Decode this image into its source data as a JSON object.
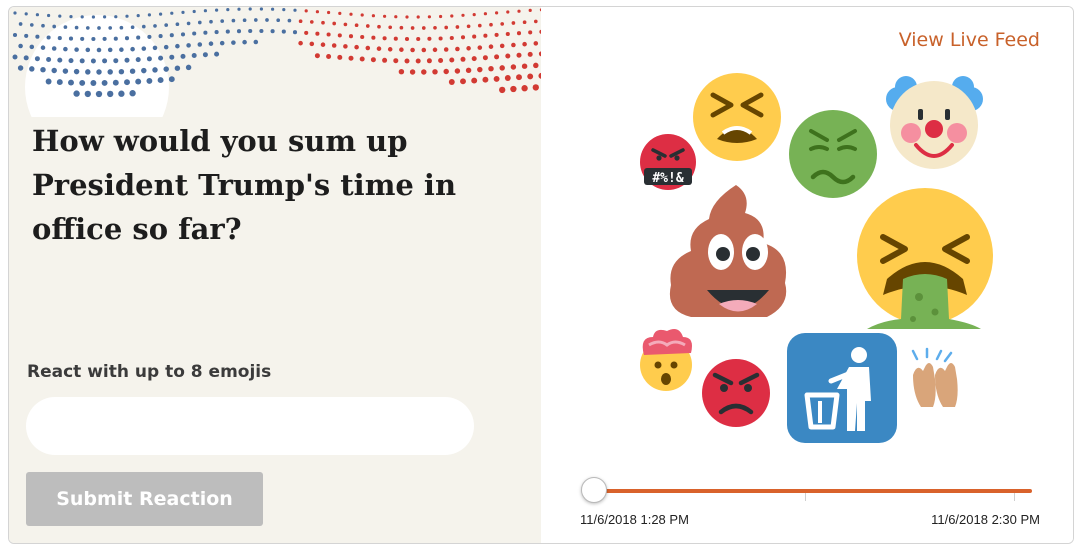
{
  "question": {
    "text": "How would you sum up President Trump's time in office so far?"
  },
  "form": {
    "react_label": "React with up to 8 emojis",
    "input_value": "",
    "input_placeholder": "",
    "submit_label": "Submit Reaction"
  },
  "feed": {
    "link_label": "View Live Feed"
  },
  "emojis": [
    {
      "name": "pouting-face-with-symbols"
    },
    {
      "name": "tired-face"
    },
    {
      "name": "nauseated-face"
    },
    {
      "name": "clown-face"
    },
    {
      "name": "pile-of-poo"
    },
    {
      "name": "face-vomiting"
    },
    {
      "name": "exploding-head"
    },
    {
      "name": "angry-face"
    },
    {
      "name": "put-litter-in-its-place"
    },
    {
      "name": "raising-hands"
    }
  ],
  "symbol_text": "#%!&",
  "timeline": {
    "start_label": "11/6/2018 1:28 PM",
    "end_label": "11/6/2018 2:30 PM",
    "position": 0
  },
  "colors": {
    "accent": "#c8612a",
    "track": "#d9622b",
    "panel_bg": "#f5f3ec",
    "button_disabled": "#bdbdbd",
    "dot_blue": "#4a6fa0",
    "dot_red": "#d23a33"
  }
}
